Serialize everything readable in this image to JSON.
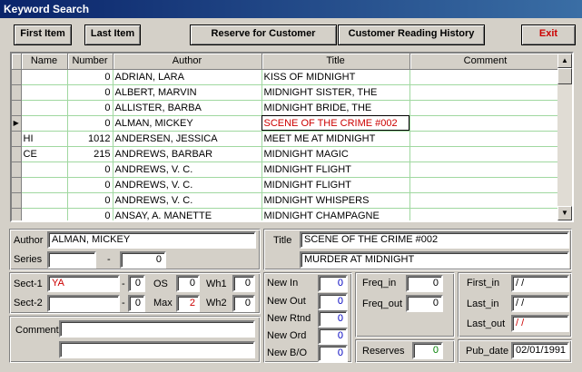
{
  "window": {
    "title": "Keyword Search"
  },
  "toolbar": {
    "first_item": "First Item",
    "last_item": "Last Item",
    "reserve": "Reserve for Customer",
    "history": "Customer Reading History",
    "exit": "Exit"
  },
  "grid": {
    "columns": [
      "Name",
      "Number",
      "Author",
      "Title",
      "Comment"
    ],
    "rows": [
      {
        "name": "",
        "number": "0",
        "author": "ADRIAN, LARA",
        "title": "KISS OF MIDNIGHT",
        "comment": ""
      },
      {
        "name": "",
        "number": "0",
        "author": "ALBERT, MARVIN",
        "title": "MIDNIGHT SISTER, THE",
        "comment": ""
      },
      {
        "name": "",
        "number": "0",
        "author": "ALLISTER, BARBA",
        "title": "MIDNIGHT BRIDE, THE",
        "comment": ""
      },
      {
        "name": "",
        "number": "0",
        "author": "ALMAN, MICKEY",
        "title": "SCENE OF THE CRIME #002",
        "comment": "",
        "current": true
      },
      {
        "name": "HI",
        "number": "1012",
        "author": "ANDERSEN, JESSICA",
        "title": "MEET ME AT MIDNIGHT",
        "comment": ""
      },
      {
        "name": "CE",
        "number": "215",
        "author": "ANDREWS, BARBAR",
        "title": "MIDNIGHT MAGIC",
        "comment": ""
      },
      {
        "name": "",
        "number": "0",
        "author": "ANDREWS, V. C.",
        "title": "MIDNIGHT FLIGHT",
        "comment": ""
      },
      {
        "name": "",
        "number": "0",
        "author": "ANDREWS, V. C.",
        "title": "MIDNIGHT FLIGHT",
        "comment": ""
      },
      {
        "name": "",
        "number": "0",
        "author": "ANDREWS, V. C.",
        "title": "MIDNIGHT WHISPERS",
        "comment": ""
      },
      {
        "name": "",
        "number": "0",
        "author": "ANSAY, A. MANETTE",
        "title": "MIDNIGHT CHAMPAGNE",
        "comment": ""
      }
    ]
  },
  "detail": {
    "author_label": "Author",
    "author_value": "ALMAN, MICKEY",
    "series_label": "Series",
    "series_value": "",
    "series_dash": "-",
    "series_num": "0",
    "title_label": "Title",
    "title_line1": "SCENE OF THE CRIME #002",
    "title_line2": "MURDER AT MIDNIGHT",
    "sect1_label": "Sect-1",
    "sect1_value": "YA",
    "sect1_dash": "-",
    "sect1_num": "0",
    "sect2_label": "Sect-2",
    "sect2_value": "",
    "sect2_dash": "-",
    "sect2_num": "0",
    "os_label": "OS",
    "os_value": "0",
    "max_label": "Max",
    "max_value": "2",
    "wh1_label": "Wh1",
    "wh1_value": "0",
    "wh2_label": "Wh2",
    "wh2_value": "0",
    "comment_label": "Comment",
    "comment_line1": "",
    "comment_line2": "",
    "new_in_label": "New In",
    "new_in": "0",
    "new_out_label": "New Out",
    "new_out": "0",
    "new_rtnd_label": "New Rtnd",
    "new_rtnd": "0",
    "new_ord_label": "New Ord",
    "new_ord": "0",
    "new_bo_label": "New B/O",
    "new_bo": "0",
    "freq_in_label": "Freq_in",
    "freq_in": "0",
    "freq_out_label": "Freq_out",
    "freq_out": "0",
    "first_in_label": "First_in",
    "first_in": " / /",
    "last_in_label": "Last_in",
    "last_in": " / /",
    "last_out_label": "Last_out",
    "last_out": " / /",
    "reserves_label": "Reserves",
    "reserves": "0",
    "pub_date_label": "Pub_date",
    "pub_date": "02/01/1991"
  }
}
